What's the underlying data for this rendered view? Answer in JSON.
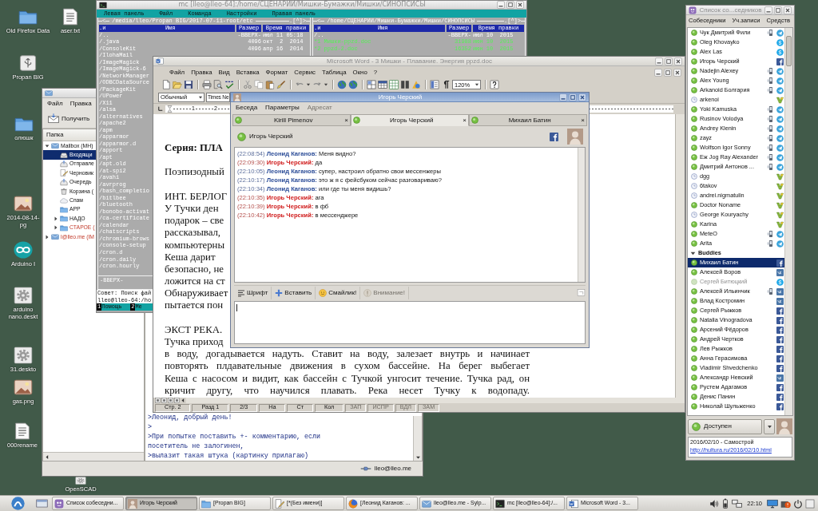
{
  "desktop_icons": [
    {
      "kind": "folder",
      "lines": [
        "Old Firefox Data"
      ]
    },
    {
      "kind": "text",
      "lines": [
        "aser.txt"
      ]
    },
    {
      "kind": "drive",
      "lines": [
        "Propan BIG"
      ]
    },
    {
      "kind": "folder",
      "lines": [
        "олюшк"
      ]
    },
    {
      "kind": "image",
      "lines": [
        "2014-08-14-",
        "pg"
      ]
    },
    {
      "kind": "arduino",
      "lines": [
        "Arduino I"
      ]
    },
    {
      "kind": "launcher",
      "lines": [
        "arduino",
        "nano.deskt"
      ]
    },
    {
      "kind": "launcher",
      "lines": [
        "31.deskto"
      ]
    },
    {
      "kind": "image",
      "lines": [
        "gas.png"
      ]
    },
    {
      "kind": "text",
      "lines": [
        "000rename"
      ]
    },
    {
      "kind": "launcher",
      "lines": [
        "OpenSCAD"
      ]
    }
  ],
  "mail_window": {
    "menu": [
      "Файл",
      "Правка"
    ],
    "toolbar": [
      {
        "label": "Получить",
        "kind": "receive"
      }
    ],
    "folder_header": "Папка",
    "folders": [
      {
        "label": "Mailbox (MH)",
        "kind": "mailbox",
        "expanded": true,
        "selected": false,
        "new": false,
        "children": [
          {
            "label": "Входящи",
            "kind": "inbox",
            "selected": true,
            "new": false
          },
          {
            "label": "Отправле",
            "kind": "sent",
            "selected": false,
            "new": false
          },
          {
            "label": "Черновик",
            "kind": "drafts",
            "selected": false,
            "new": false
          },
          {
            "label": "Очередь",
            "kind": "queue",
            "selected": false,
            "new": false
          },
          {
            "label": "Корзина (",
            "kind": "trash",
            "selected": false,
            "new": false
          },
          {
            "label": "Спам",
            "kind": "spam",
            "selected": false,
            "new": false
          },
          {
            "label": "APP",
            "kind": "folder",
            "selected": false,
            "new": false
          },
          {
            "label": "НАДО",
            "kind": "folder",
            "expanded": false,
            "selected": false,
            "new": false
          },
          {
            "label": "СТАРОЕ (",
            "kind": "folder",
            "expanded": false,
            "selected": false,
            "new": true
          }
        ]
      },
      {
        "label": "l@lleo.me (IM",
        "kind": "mailbox",
        "expanded": false,
        "selected": false,
        "new": true
      }
    ],
    "message_lines": [
      ">Леонид, добрый день!",
      ">",
      ">При попытке поставить +- комментарию, если",
      "посетитель не залогинен,",
      ">вылазит такая штука (картинку прилагаю)"
    ],
    "status": "lleo@lleo.me"
  },
  "terminal_window": {
    "title": "mc [lleo@lleo-64]:/home/СЦЕНАРИИ/Мишки-Бумажки/Мишки/СИНОПСИСЫ",
    "menu": [
      "Левая панель",
      "Файл",
      "Команда",
      "Настройки",
      "Правая панель"
    ],
    "left_panel": {
      "nav": "<",
      "path": "/media/lleo/Propan BIG/2017-07-11-root/etc",
      "history": ".[^]>",
      "columns": [
        ".и",
        "Имя",
        "Размер",
        "Время правки"
      ],
      "rows": [
        {
          "name": "/..",
          "size": "-ВВЕРХ-",
          "time": "июл 11 05:18"
        },
        {
          "name": "/.java",
          "size": "4096",
          "time": "окт  2  2014"
        },
        {
          "name": "/ConsoleKit",
          "size": "4096",
          "time": "апр 16  2014"
        },
        {
          "name": "/IlohaMail"
        },
        {
          "name": "/ImageMagick"
        },
        {
          "name": "/ImageMagick-6"
        },
        {
          "name": "/NetworkManager"
        },
        {
          "name": "/ODBCDataSource"
        },
        {
          "name": "/PackageKit"
        },
        {
          "name": "/UPower"
        },
        {
          "name": "/X11"
        },
        {
          "name": "/alsa"
        },
        {
          "name": "/alternatives"
        },
        {
          "name": "/apache2"
        },
        {
          "name": "/apm"
        },
        {
          "name": "/apparmor"
        },
        {
          "name": "/apparmor.d"
        },
        {
          "name": "/apport"
        },
        {
          "name": "/apt"
        },
        {
          "name": "/apt.old"
        },
        {
          "name": "/at-spi2"
        },
        {
          "name": "/avahi"
        },
        {
          "name": "/avrprog"
        },
        {
          "name": "/bash_completio"
        },
        {
          "name": "/bitlbee"
        },
        {
          "name": "/bluetooth"
        },
        {
          "name": "/bonobo-activat"
        },
        {
          "name": "/ca-certificate"
        },
        {
          "name": "/calendar"
        },
        {
          "name": "/chatscripts"
        },
        {
          "name": "/chromium-brows"
        },
        {
          "name": "/console-setup"
        },
        {
          "name": "/cron.d"
        },
        {
          "name": "/cron.daily"
        },
        {
          "name": "/cron.hourly"
        }
      ],
      "footer": "-ВВЕРХ-"
    },
    "right_panel": {
      "nav": "<",
      "path": "/home/СЦЕНАРИИ/Мишки-Бумажки/Мишки/СИНОПСИСЫ",
      "history": ".[^]>",
      "columns": [
        ".и",
        "Имя",
        "Размер",
        "Время правки"
      ],
      "rows": [
        {
          "name": "/..",
          "size": "-ВВЕРХ-",
          "time": "июл 10  2015",
          "kind": "dir"
        },
        {
          "name": "*1 Мишки-ppzd.doc",
          "size": "31988",
          "time": "июн 10  2015",
          "kind": "exec"
        },
        {
          "name": "*2 ppzd-2.doc",
          "size": "16352",
          "time": "июн 10  2015",
          "kind": "exec"
        }
      ]
    },
    "hint": "Совет: Поиск фай",
    "prompt": "lleo@lleo-64:/ho",
    "keys": [
      {
        "number": "1",
        "label": "Помощь"
      },
      {
        "number": "2",
        "label": "Ме"
      }
    ]
  },
  "word_window": {
    "title": "Microsoft Word - 3 Мишки - Плавание. Энергия ppzd.doc",
    "menu": [
      "Файл",
      "Правка",
      "Вид",
      "Вставка",
      "Формат",
      "Сервис",
      "Таблица",
      "Окно",
      "?"
    ],
    "zoom": "120%",
    "style": "Обычный",
    "font": "Times Ne",
    "ruler": [
      "1",
      "2"
    ],
    "paragraphs": [
      {
        "kind": "heading",
        "lines": [
          {
            "text": "Серия: ПЛА",
            "justified": false
          }
        ]
      },
      {
        "kind": "body",
        "lines": [
          {
            "text": "Поэпизодный",
            "justified": false
          }
        ]
      },
      {
        "kind": "body",
        "lines": [
          {
            "text": "ИНТ. БЕРЛОГ",
            "justified": false
          },
          {
            "text": "У Тучки ден",
            "justified": false
          },
          {
            "text": "подарок – све",
            "justified": false
          },
          {
            "text": "рассказывал,",
            "justified": false
          },
          {
            "text": "компьютерны",
            "justified": false
          },
          {
            "text": "Кеша дарит",
            "justified": false
          },
          {
            "text": "безопасно, не",
            "justified": false
          },
          {
            "text": "ложится на ст",
            "justified": false
          },
          {
            "text": "Обнаруживает",
            "justified": false
          },
          {
            "text": "пытается пон",
            "justified": false
          }
        ]
      },
      {
        "kind": "body",
        "lines": [
          {
            "text": "ЭКСТ РЕКА.",
            "justified": false
          },
          {
            "text": "Тучка приход",
            "justified": false
          },
          {
            "text": "в воду, догадывается надуть. Ставит на воду, залезает внутрь и начинает",
            "justified": true
          },
          {
            "text": "повторять плдавательные движения в сухом бассейне. На берег выбегает",
            "justified": true
          },
          {
            "text": "Кеша с насосом и видит, как бассейн с Тучкой унгосит течение. Тучка рад, он",
            "justified": true
          },
          {
            "text": "кричит другу, что научился плавать. Река несет Тучку к водопаду.",
            "justified": true
          }
        ]
      }
    ],
    "status": [
      {
        "text": "Стр. 2",
        "disabled": false
      },
      {
        "text": "Разд 1",
        "disabled": false
      },
      {
        "text": "2/3",
        "disabled": false
      },
      {
        "text": "На",
        "disabled": false
      },
      {
        "text": "Ст",
        "disabled": false
      },
      {
        "text": "Кол",
        "disabled": false
      },
      {
        "text": "ЗАП",
        "disabled": true
      },
      {
        "text": "ИСПР",
        "disabled": true
      },
      {
        "text": "ВДЛ",
        "disabled": true
      },
      {
        "text": "ЗАМ",
        "disabled": true
      }
    ]
  },
  "chat_window": {
    "title": "Игорь Черский",
    "menu": [
      {
        "label": "Беседа",
        "disabled": false
      },
      {
        "label": "Параметры",
        "disabled": false
      },
      {
        "label": "Адресат",
        "disabled": true
      }
    ],
    "tabs": [
      {
        "label": "Kirill Pimenov",
        "online": true,
        "close": "×",
        "selected": false
      },
      {
        "label": "Игорь Черский",
        "online": true,
        "close": "×",
        "selected": true
      },
      {
        "label": "Михаил Батин",
        "online": true,
        "close": "×",
        "selected": false
      }
    ],
    "contact": {
      "name": "Игорь Черский",
      "online": true,
      "kind": "facebook"
    },
    "messages": [
      {
        "time": "(22:08:54)",
        "sender": "Леонид Каганов:",
        "text": "Меня видно?",
        "kind": "sent"
      },
      {
        "time": "(22:09:30)",
        "sender": "Игорь Черский:",
        "text": "да",
        "kind": "received"
      },
      {
        "time": "(22:10:05)",
        "sender": "Леонид Каганов:",
        "text": "супер, настроил обратно свои мессенжеры",
        "kind": "sent"
      },
      {
        "time": "(22:10:17)",
        "sender": "Леонид Каганов:",
        "text": "это ж я с фейсбуком сейчас разговариваю?",
        "kind": "sent"
      },
      {
        "time": "(22:10:34)",
        "sender": "Леонид Каганов:",
        "text": "или где ты меня видишь?",
        "kind": "sent"
      },
      {
        "time": "(22:10:35)",
        "sender": "Игорь Черский:",
        "text": "ага",
        "kind": "received"
      },
      {
        "time": "(22:10:39)",
        "sender": "Игорь Черский:",
        "text": "в фб",
        "kind": "received"
      },
      {
        "time": "(22:10:42)",
        "sender": "Игорь Черский:",
        "text": "в мессенджере",
        "kind": "received"
      }
    ],
    "toolbar": [
      {
        "label": "Шрифт",
        "kind": "font",
        "disabled": false
      },
      {
        "label": "Вставить",
        "kind": "insert",
        "disabled": false
      },
      {
        "label": "Смайлик!",
        "kind": "smiley",
        "disabled": false
      },
      {
        "label": "Внимание!",
        "kind": "attention",
        "disabled": true
      }
    ]
  },
  "buddy_window": {
    "title": "Список со...седников",
    "menu": [
      "Собеседники",
      "Уч.записи",
      "Средств"
    ],
    "contacts": [
      {
        "name": "Чук Дмитрий Фили",
        "kind": "telegram",
        "away": false,
        "idle": false,
        "phone": true,
        "selected": false
      },
      {
        "name": "Oleg Khovayko",
        "kind": "skype",
        "away": false,
        "idle": false,
        "phone": false,
        "selected": false
      },
      {
        "name": "Alex Las",
        "kind": "skype",
        "away": false,
        "idle": false,
        "phone": false,
        "selected": false
      },
      {
        "name": "Игорь Черский",
        "kind": "facebook",
        "away": false,
        "idle": false,
        "phone": false,
        "selected": false
      },
      {
        "name": "Nadejin Alexey",
        "kind": "telegram",
        "away": false,
        "idle": false,
        "phone": true,
        "selected": false
      },
      {
        "name": "Alex Young",
        "kind": "telegram",
        "away": false,
        "idle": false,
        "phone": true,
        "selected": false
      },
      {
        "name": "Arkanoid Болгария",
        "kind": "telegram",
        "away": false,
        "idle": false,
        "phone": true,
        "selected": false
      },
      {
        "name": "arkenoi",
        "kind": "jabber",
        "away": true,
        "idle": false,
        "phone": false,
        "selected": false
      },
      {
        "name": "Yoki Kamuska",
        "kind": "telegram",
        "away": false,
        "idle": false,
        "phone": true,
        "selected": false
      },
      {
        "name": "Rusinov Volodya",
        "kind": "telegram",
        "away": false,
        "idle": false,
        "phone": true,
        "selected": false
      },
      {
        "name": "Andrey Klenin",
        "kind": "telegram",
        "away": false,
        "idle": false,
        "phone": true,
        "selected": false
      },
      {
        "name": "zayz",
        "kind": "telegram",
        "away": false,
        "idle": false,
        "phone": true,
        "selected": false
      },
      {
        "name": "Wolfson Igor Sonny",
        "kind": "telegram",
        "away": false,
        "idle": false,
        "phone": true,
        "selected": false
      },
      {
        "name": "Еж Jog Ray Alexander",
        "kind": "telegram",
        "away": false,
        "idle": false,
        "phone": true,
        "selected": false
      },
      {
        "name": "Дмитрий Антонов ...",
        "kind": "telegram",
        "away": false,
        "idle": false,
        "phone": true,
        "selected": false
      },
      {
        "name": "dgg",
        "kind": "jabber",
        "away": true,
        "idle": false,
        "phone": false,
        "selected": false
      },
      {
        "name": "6takov",
        "kind": "jabber",
        "away": true,
        "idle": false,
        "phone": false,
        "selected": false
      },
      {
        "name": "andrei.nigmatulin",
        "kind": "jabber",
        "away": true,
        "idle": false,
        "phone": false,
        "selected": false
      },
      {
        "name": "Doctor Noname",
        "kind": "jabber",
        "away": false,
        "idle": false,
        "phone": false,
        "selected": false
      },
      {
        "name": "George Kouryachy",
        "kind": "jabber",
        "away": true,
        "idle": false,
        "phone": false,
        "selected": false
      },
      {
        "name": "Karina",
        "kind": "jabber",
        "away": false,
        "idle": false,
        "phone": false,
        "selected": false
      },
      {
        "name": "MeteO",
        "kind": "telegram",
        "away": false,
        "idle": false,
        "phone": true,
        "selected": false
      },
      {
        "name": "Arita",
        "kind": "telegram",
        "away": false,
        "idle": false,
        "phone": true,
        "selected": false
      }
    ],
    "groups": [
      {
        "label": "Buddies",
        "expanded": true,
        "contacts": [
          {
            "name": "Михаил Батин",
            "kind": "facebook",
            "away": false,
            "idle": false,
            "phone": false,
            "selected": true
          },
          {
            "name": "Алексей Воров",
            "kind": "vk",
            "away": false,
            "idle": false,
            "phone": false,
            "selected": false
          },
          {
            "name": "Сергей Битюцкий",
            "kind": "skype",
            "away": false,
            "idle": true,
            "phone": false,
            "selected": false
          },
          {
            "name": "Алексей Ильинчик",
            "kind": "vk",
            "away": false,
            "idle": false,
            "phone": true,
            "selected": false
          },
          {
            "name": "Влад Костромин",
            "kind": "vk",
            "away": false,
            "idle": false,
            "phone": false,
            "selected": false
          },
          {
            "name": "Сергей Рыжков",
            "kind": "facebook",
            "away": false,
            "idle": false,
            "phone": false,
            "selected": false
          },
          {
            "name": "Natalia Vinogradova",
            "kind": "facebook",
            "away": false,
            "idle": false,
            "phone": false,
            "selected": false
          },
          {
            "name": "Арсений Фёдоров",
            "kind": "facebook",
            "away": false,
            "idle": false,
            "phone": false,
            "selected": false
          },
          {
            "name": "Андрей Чертков",
            "kind": "facebook",
            "away": false,
            "idle": false,
            "phone": false,
            "selected": false
          },
          {
            "name": "Лев Рыжков",
            "kind": "facebook",
            "away": false,
            "idle": false,
            "phone": false,
            "selected": false
          },
          {
            "name": "Анна Герасимова",
            "kind": "facebook",
            "away": false,
            "idle": false,
            "phone": false,
            "selected": false
          },
          {
            "name": "Vladimir Shvedchenko",
            "kind": "facebook",
            "away": false,
            "idle": false,
            "phone": false,
            "selected": false
          },
          {
            "name": "Александр Невский",
            "kind": "vk",
            "away": false,
            "idle": false,
            "phone": false,
            "selected": false
          },
          {
            "name": "Рустем Адагамов",
            "kind": "facebook",
            "away": false,
            "idle": false,
            "phone": false,
            "selected": false
          },
          {
            "name": "Денис Панин",
            "kind": "facebook",
            "away": false,
            "idle": false,
            "phone": false,
            "selected": false
          },
          {
            "name": "Николай Шульженко",
            "kind": "facebook",
            "away": false,
            "idle": false,
            "phone": false,
            "selected": false
          }
        ]
      }
    ],
    "status_selector": {
      "label": "Доступен",
      "online": true
    },
    "status_message": {
      "text": "2016/02/10 - Самострой",
      "link": "http://hultura.ru/2016/02/10.html"
    }
  },
  "taskbar": {
    "tasks": [
      {
        "label": "Список собеседни...",
        "kind": "chat",
        "selected": false
      },
      {
        "label": "Игорь Черский",
        "kind": "avatar",
        "selected": true
      },
      {
        "label": "[Propan BIG]",
        "kind": "folder",
        "selected": false
      },
      {
        "label": "[*(Без имени)]",
        "kind": "editor",
        "selected": false
      },
      {
        "label": "[Леонид Каганов: ...",
        "kind": "browser",
        "selected": false
      },
      {
        "label": "lleo@lleo.me - Sylp...",
        "kind": "mail",
        "selected": false
      },
      {
        "label": "mc [lleo@lleo-64]:/...",
        "kind": "terminal",
        "selected": false
      },
      {
        "label": "Microsoft Word - 3...",
        "kind": "word",
        "selected": false
      }
    ],
    "clock": "22:10"
  }
}
